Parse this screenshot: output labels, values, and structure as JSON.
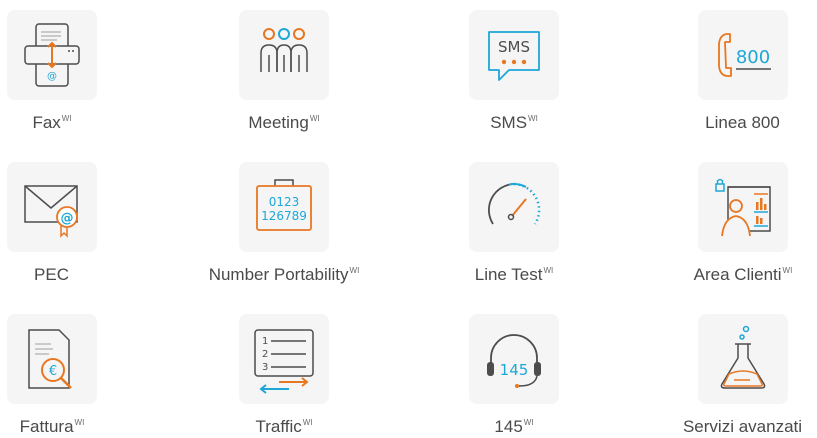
{
  "colors": {
    "gray": "#4d4d4d",
    "orange": "#e87722",
    "blue": "#1ea7d8",
    "tile_bg": "#f5f5f5",
    "label": "#4a4a4a"
  },
  "services": [
    {
      "label": "Fax",
      "sup": "WI",
      "icon": "fax-icon"
    },
    {
      "label": "Meeting",
      "sup": "WI",
      "icon": "meeting-icon"
    },
    {
      "label": "SMS",
      "sup": "WI",
      "icon": "sms-icon",
      "icon_text": "SMS"
    },
    {
      "label": "Linea 800",
      "sup": "",
      "icon": "phone-800-icon",
      "icon_text": "800"
    },
    {
      "label": "PEC",
      "sup": "",
      "icon": "certified-mail-icon"
    },
    {
      "label": "Number Portability",
      "sup": "WI",
      "icon": "number-portability-icon",
      "icon_text_1": "0123",
      "icon_text_2": "126789"
    },
    {
      "label": "Line Test",
      "sup": "WI",
      "icon": "gauge-icon"
    },
    {
      "label": "Area Clienti",
      "sup": "WI",
      "icon": "client-dashboard-icon"
    },
    {
      "label": "Fattura",
      "sup": "WI",
      "icon": "invoice-icon",
      "icon_text": "€"
    },
    {
      "label": "Traffic",
      "sup": "WI",
      "icon": "traffic-list-icon",
      "icon_text_1": "1",
      "icon_text_2": "2",
      "icon_text_3": "3"
    },
    {
      "label": "145",
      "sup": "WI",
      "icon": "headset-icon",
      "icon_text": "145"
    },
    {
      "label": "Servizi avanzati",
      "sup": "",
      "icon": "flask-icon"
    }
  ]
}
